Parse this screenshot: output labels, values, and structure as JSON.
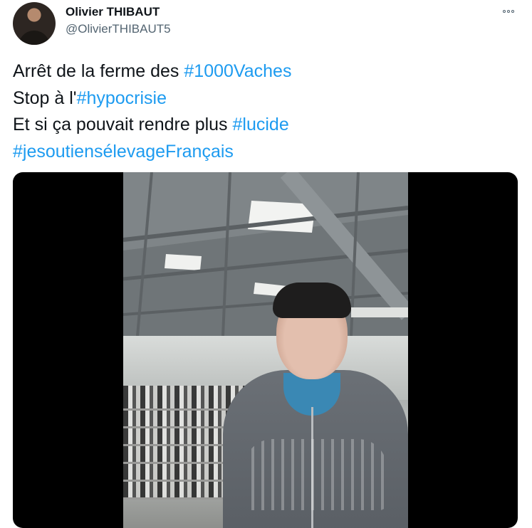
{
  "author": {
    "display_name": "Olivier THIBAUT",
    "handle": "@OlivierTHIBAUT5"
  },
  "tweet": {
    "lines": [
      [
        {
          "text": "Arrêt de la ferme des ",
          "hashtag": false
        },
        {
          "text": "#1000Vaches",
          "hashtag": true
        }
      ],
      [
        {
          "text": "Stop à l'",
          "hashtag": false
        },
        {
          "text": "#hypocrisie",
          "hashtag": true
        }
      ],
      [
        {
          "text": "Et si ça pouvait rendre plus ",
          "hashtag": false
        },
        {
          "text": "#lucide",
          "hashtag": true
        }
      ],
      [
        {
          "text": "#jesoutiensélevageFrançais",
          "hashtag": true
        }
      ]
    ]
  },
  "icons": {
    "more": "more-options-icon"
  },
  "colors": {
    "hashtag": "#1d9bf0",
    "text": "#0f1419",
    "secondary": "#536471",
    "media_background": "#000000"
  }
}
